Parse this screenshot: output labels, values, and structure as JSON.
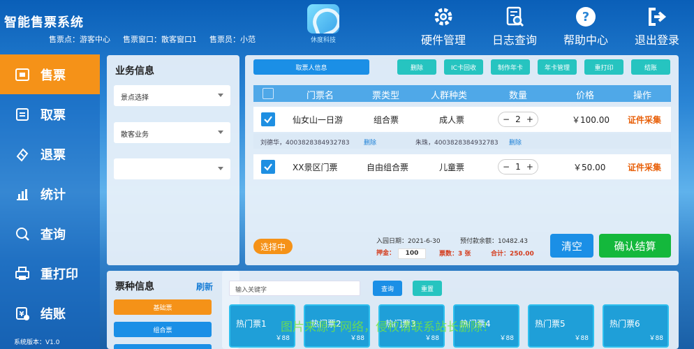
{
  "header": {
    "app_title": "智能售票系统",
    "sale_point": "售票点：游客中心",
    "window": "售票窗口：散客窗口1",
    "clerk": "售票员：小范",
    "logo_text": "休度科技",
    "tools": [
      {
        "label": "硬件管理",
        "icon": "gear-icon"
      },
      {
        "label": "日志查询",
        "icon": "log-search-icon"
      },
      {
        "label": "帮助中心",
        "icon": "help-icon"
      },
      {
        "label": "退出登录",
        "icon": "logout-icon"
      }
    ]
  },
  "sidebar": {
    "items": [
      {
        "label": "售票",
        "icon": "ticket-sale-icon",
        "active": true
      },
      {
        "label": "取票",
        "icon": "ticket-pickup-icon"
      },
      {
        "label": "退票",
        "icon": "refund-icon"
      },
      {
        "label": "统计",
        "icon": "chart-icon"
      },
      {
        "label": "查询",
        "icon": "query-icon"
      },
      {
        "label": "重打印",
        "icon": "printer-icon"
      },
      {
        "label": "结账",
        "icon": "checkout-icon"
      }
    ],
    "version": "系统版本：V1.0"
  },
  "business": {
    "title": "业务信息",
    "selects": [
      "景点选择",
      "散客业务",
      ""
    ]
  },
  "order": {
    "buttons": {
      "buyer_info": "取票人信息",
      "delete": "删除",
      "ic_recycle": "IC卡回收",
      "make_card": "制作年卡",
      "card_manage": "年卡管理",
      "reprint": "重打印",
      "checkout": "结账"
    },
    "columns": [
      "门票名",
      "票类型",
      "人群种类",
      "数量",
      "价格",
      "操作"
    ],
    "rows": [
      {
        "name": "仙女山一日游",
        "type": "组合票",
        "crowd": "成人票",
        "qty": "2",
        "price": "￥100.00",
        "action": "证件采集"
      },
      {
        "name": "XX景区门票",
        "type": "自由组合票",
        "crowd": "儿童票",
        "qty": "1",
        "price": "￥50.00",
        "action": "证件采集"
      }
    ],
    "people": [
      {
        "text": "刘德华，4003828384932783",
        "del": "删除"
      },
      {
        "text": "朱珠，4003828384932783",
        "del": "删除"
      }
    ],
    "status": "选择中",
    "entry_date": "入园日期：2021-6-30",
    "prepaid": "预付款余额：10482.43",
    "deposit_label": "押金：",
    "deposit_value": "100",
    "ticket_count": "票数：3 张",
    "total": "合计：250.00",
    "clear": "清空",
    "confirm": "确认结算"
  },
  "ticket_types": {
    "title": "票种信息",
    "refresh": "刷新",
    "categories": [
      "基础票",
      "组合票"
    ]
  },
  "hot": {
    "search_placeholder": "输入关键字",
    "query": "查询",
    "reset": "重置",
    "cards": [
      {
        "name": "热门票1",
        "price": "￥88"
      },
      {
        "name": "热门票2",
        "price": "￥88"
      },
      {
        "name": "热门票3",
        "price": "￥88"
      },
      {
        "name": "热门票4",
        "price": "￥88"
      },
      {
        "name": "热门票5",
        "price": "￥88"
      },
      {
        "name": "热门票6",
        "price": "￥88"
      }
    ]
  },
  "watermark": "图片来源于网络，侵权请联系站长删除！",
  "colors": {
    "accent": "#f59218",
    "primary": "#1b8fe6",
    "teal": "#26c4c0",
    "confirm": "#14b83c",
    "warn": "#e8600a"
  }
}
